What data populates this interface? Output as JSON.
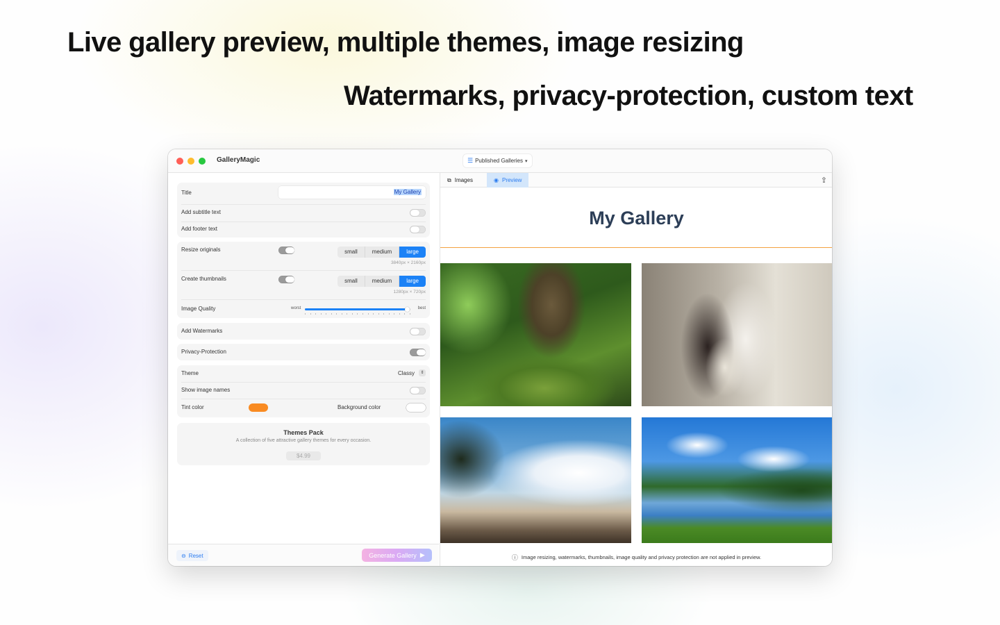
{
  "headlines": {
    "primary": "Live gallery preview, multiple themes, image resizing",
    "secondary": "Watermarks, privacy-protection, custom text"
  },
  "window": {
    "app_title": "GalleryMagic",
    "galleries_menu": "Published Galleries"
  },
  "settings": {
    "title_label": "Title",
    "title_value": "My Gallery",
    "subtitle_label": "Add subtitle text",
    "subtitle_enabled": false,
    "footer_label": "Add footer text",
    "footer_enabled": false,
    "resize_label": "Resize originals",
    "resize_enabled": true,
    "resize_options": [
      "small",
      "medium",
      "large"
    ],
    "resize_selected": "large",
    "resize_dims": "3840px × 2160px",
    "thumbs_label": "Create thumbnails",
    "thumbs_enabled": true,
    "thumbs_options": [
      "small",
      "medium",
      "large"
    ],
    "thumbs_selected": "large",
    "thumbs_dims": "1280px × 720px",
    "quality_label": "Image Quality",
    "quality_min": "worst",
    "quality_max": "best",
    "quality_value": 0.97,
    "watermarks_label": "Add Watermarks",
    "watermarks_enabled": false,
    "privacy_label": "Privacy-Protection",
    "privacy_enabled": true,
    "theme_label": "Theme",
    "theme_value": "Classy",
    "show_names_label": "Show image names",
    "show_names_enabled": false,
    "tint_label": "Tint color",
    "tint_color": "#f98b22",
    "bg_label": "Background color",
    "bg_color": "#ffffff"
  },
  "themes_pack": {
    "title": "Themes Pack",
    "description": "A collection of five attractive gallery themes for every occasion.",
    "price": "$4.99"
  },
  "footer": {
    "reset_label": "Reset",
    "generate_label": "Generate Gallery"
  },
  "preview": {
    "tabs": [
      {
        "label": "Images",
        "icon": "photo-stack-icon"
      },
      {
        "label": "Preview",
        "icon": "eye-icon"
      }
    ],
    "active_tab": "Preview",
    "gallery_title": "My Gallery",
    "accent_color": "#f3a140",
    "photos": [
      "forest-tree-photo",
      "wedding-couple-photo",
      "tropical-beach-photo",
      "forest-lake-photo"
    ],
    "notice": "Image resizing, watermarks, thumbnails, image quality and privacy protection are not applied in preview."
  }
}
